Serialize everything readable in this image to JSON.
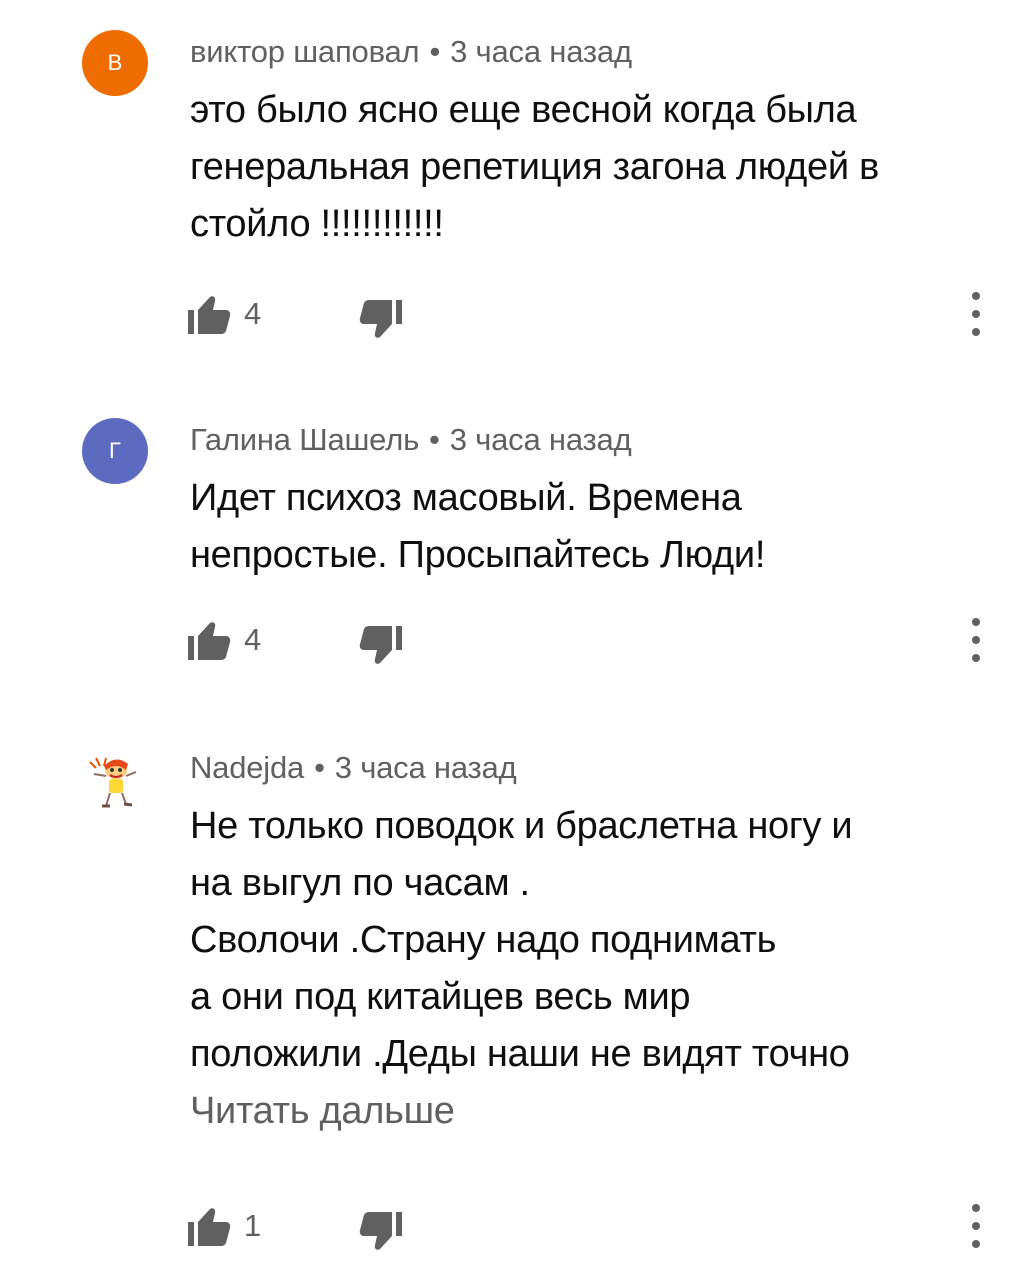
{
  "comments": [
    {
      "author": "виктор шаповал",
      "avatar_letter": "В",
      "avatar_color": "#ef6c00",
      "separator": "•",
      "time": "3 часа назад",
      "lines": [
        "это было ясно еще весной когда была",
        "генеральная репетиция загона людей в",
        "стойло !!!!!!!!!!!!"
      ],
      "likes": "4"
    },
    {
      "author": "Галина Шашель",
      "avatar_letter": "Г",
      "avatar_color": "#5c6bc0",
      "separator": "•",
      "time": "3 часа назад",
      "lines": [
        "Идет психоз масовый. Времена",
        "непростые. Просыпайтесь Люди!"
      ],
      "likes": "4"
    },
    {
      "author": "Nadejda",
      "avatar_letter": "",
      "avatar_color": "#ffffff",
      "separator": "•",
      "time": "3 часа назад",
      "lines": [
        "Не только поводок и браслетна ногу  и",
        "на выгул по часам .",
        "Сволочи .Страну надо поднимать",
        "а они под китайцев весь мир",
        "положили .Деды наши не видят точно"
      ],
      "read_more": "Читать дальше",
      "likes": "1"
    }
  ],
  "icons": {
    "like": "thumb-up-icon",
    "dislike": "thumb-down-icon",
    "menu": "more-vert-icon"
  }
}
